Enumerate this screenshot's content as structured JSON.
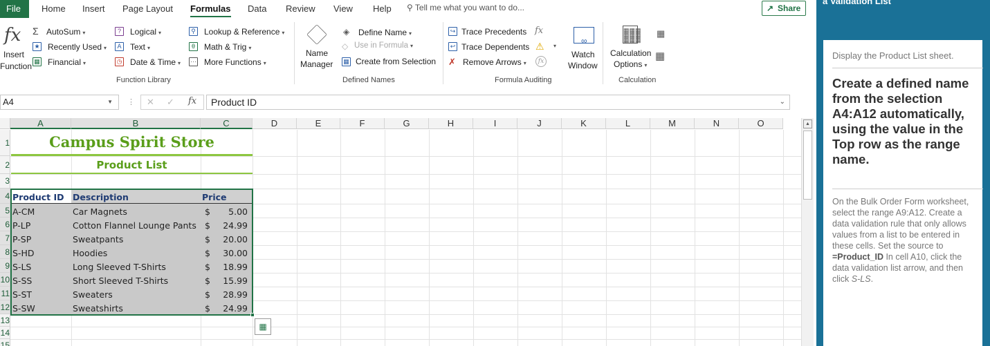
{
  "menu": {
    "file": "File",
    "tabs": [
      "Home",
      "Insert",
      "Page Layout",
      "Formulas",
      "Data",
      "Review",
      "View",
      "Help"
    ],
    "tell_me": "Tell me what you want to do...",
    "share": "Share"
  },
  "ribbon": {
    "insert_function": {
      "line1": "Insert",
      "line2": "Function"
    },
    "function_library": {
      "autosum": "AutoSum",
      "recently_used": "Recently Used",
      "financial": "Financial",
      "logical": "Logical",
      "text": "Text",
      "date_time": "Date & Time",
      "lookup_reference": "Lookup & Reference",
      "math_trig": "Math & Trig",
      "more_functions": "More Functions",
      "label": "Function Library"
    },
    "defined_names": {
      "name_manager": {
        "line1": "Name",
        "line2": "Manager"
      },
      "define_name": "Define Name",
      "use_in_formula": "Use in Formula",
      "create_from_selection": "Create from Selection",
      "label": "Defined Names"
    },
    "formula_auditing": {
      "trace_precedents": "Trace Precedents",
      "trace_dependents": "Trace Dependents",
      "remove_arrows": "Remove Arrows",
      "watch_window": {
        "line1": "Watch",
        "line2": "Window"
      },
      "label": "Formula Auditing"
    },
    "calculation": {
      "options_line1": "Calculation",
      "options_line2": "Options",
      "label": "Calculation"
    }
  },
  "formula_bar": {
    "name_box": "A4",
    "fx": "fx",
    "content": "Product ID"
  },
  "columns": [
    "A",
    "B",
    "C",
    "D",
    "E",
    "F",
    "G",
    "H",
    "I",
    "J",
    "K",
    "L",
    "M",
    "N",
    "O"
  ],
  "rows": [
    "1",
    "2",
    "3",
    "4",
    "5",
    "6",
    "7",
    "8",
    "9",
    "10",
    "11",
    "12",
    "13",
    "14",
    "15"
  ],
  "sheet": {
    "title": "Campus Spirit Store",
    "subtitle": "Product List",
    "headers": {
      "id": "Product ID",
      "desc": "Description",
      "price": "Price"
    },
    "products": [
      {
        "id": "A-CM",
        "desc": "Car Magnets",
        "cur": "$",
        "price": "5.00"
      },
      {
        "id": "P-LP",
        "desc": "Cotton Flannel Lounge Pants",
        "cur": "$",
        "price": "24.99"
      },
      {
        "id": "P-SP",
        "desc": "Sweatpants",
        "cur": "$",
        "price": "20.00"
      },
      {
        "id": "S-HD",
        "desc": "Hoodies",
        "cur": "$",
        "price": "30.00"
      },
      {
        "id": "S-LS",
        "desc": "Long Sleeved T-Shirts",
        "cur": "$",
        "price": "18.99"
      },
      {
        "id": "S-SS",
        "desc": "Short Sleeved T-Shirts",
        "cur": "$",
        "price": "15.99"
      },
      {
        "id": "S-ST",
        "desc": "Sweaters",
        "cur": "$",
        "price": "28.99"
      },
      {
        "id": "S-SW",
        "desc": "Sweatshirts",
        "cur": "$",
        "price": "24.99"
      }
    ]
  },
  "side_panel": {
    "header_fragment": "a Validation List",
    "step_prev": "Display the Product List sheet.",
    "step_current": "Create a defined name from the selection A4:A12 automatically, using the value in the Top row as the range name.",
    "step_next_part1": "On the Bulk Order Form worksheet, select the range A9:A12. Create a data validation rule that only allows values from a list to be entered in these cells. Set the source to ",
    "step_next_bold": "=Product_ID",
    "step_next_part2": " In cell A10, click the data validation list arrow, and then click ",
    "step_next_italic": "S-LS",
    "step_next_end": "."
  },
  "colors": {
    "excel_green": "#217346",
    "title_green": "#5a9e1a",
    "header_blue": "#1f3b73",
    "selection_gray": "#c9c9c9",
    "panel_blue": "#1a7197"
  }
}
